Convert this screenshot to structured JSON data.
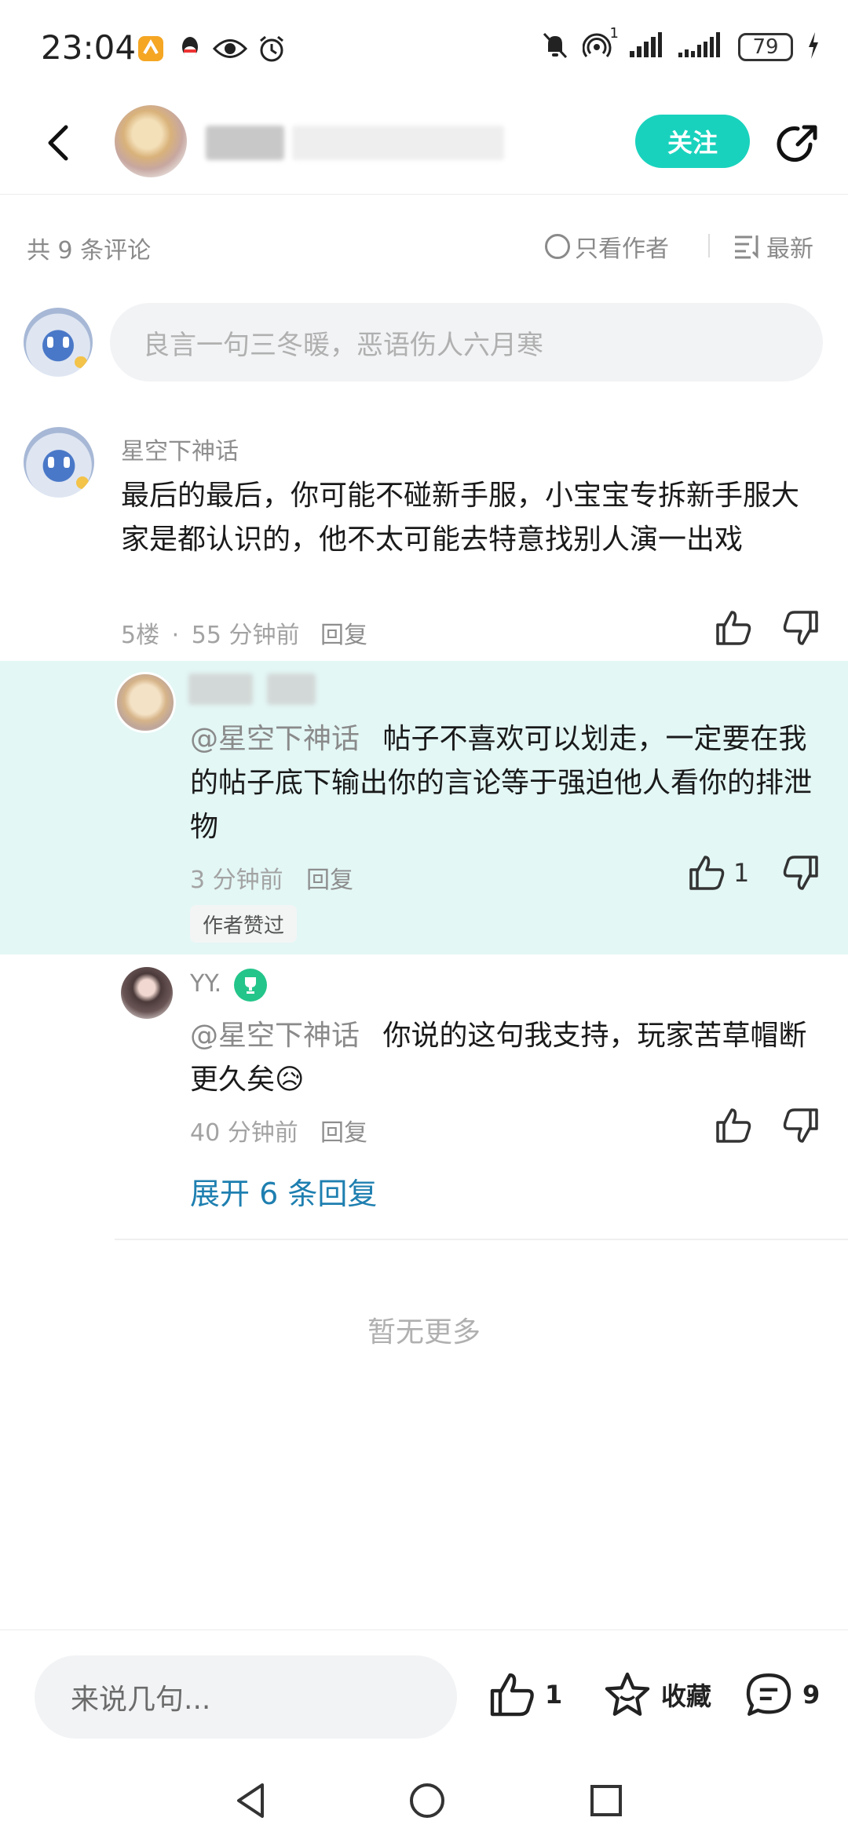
{
  "status_bar": {
    "time": "23:04",
    "battery": "79",
    "signal_label": "1",
    "icons": [
      "app-notification-icon",
      "qq-icon",
      "eye-icon",
      "alarm-icon",
      "mute-icon",
      "hotspot-icon",
      "signal-icon",
      "signal-icon",
      "battery-icon",
      "charging-icon"
    ]
  },
  "header": {
    "follow_label": "关注",
    "back_icon": "chevron-left-icon",
    "share_icon": "share-icon"
  },
  "filters": {
    "count_text": "共 9 条评论",
    "only_author": "只看作者",
    "sort": "最新"
  },
  "input": {
    "placeholder": "良言一句三冬暖，恶语伤人六月寒"
  },
  "comment": {
    "name": "星空下神话",
    "text": "最后的最后，你可能不碰新手服，小宝宝专拆新手服大家是都认识的，他不太可能去特意找别人演一出戏",
    "floor": "5楼",
    "separator": "·",
    "time": "55 分钟前",
    "reply_label": "回复"
  },
  "replies": [
    {
      "mention": "@星空下神话",
      "text": "帖子不喜欢可以划走，一定要在我的帖子底下输出你的言论等于强迫他人看你的排泄物",
      "time": "3 分钟前",
      "reply_label": "回复",
      "likes": "1",
      "tag": "作者赞过"
    },
    {
      "name": "YY.",
      "mention": "@星空下神话",
      "text": "你说的这句我支持，玩家苦草帽断更久矣😥",
      "time": "40 分钟前",
      "reply_label": "回复"
    }
  ],
  "expand_label": "展开 6 条回复",
  "no_more": "暂无更多",
  "bottom_bar": {
    "placeholder": "来说几句...",
    "likes": "1",
    "collect_label": "收藏",
    "comments": "9"
  },
  "colors": {
    "accent": "#19d2bd",
    "highlight_bg": "#e3f7f5",
    "link": "#1e7fb0"
  }
}
